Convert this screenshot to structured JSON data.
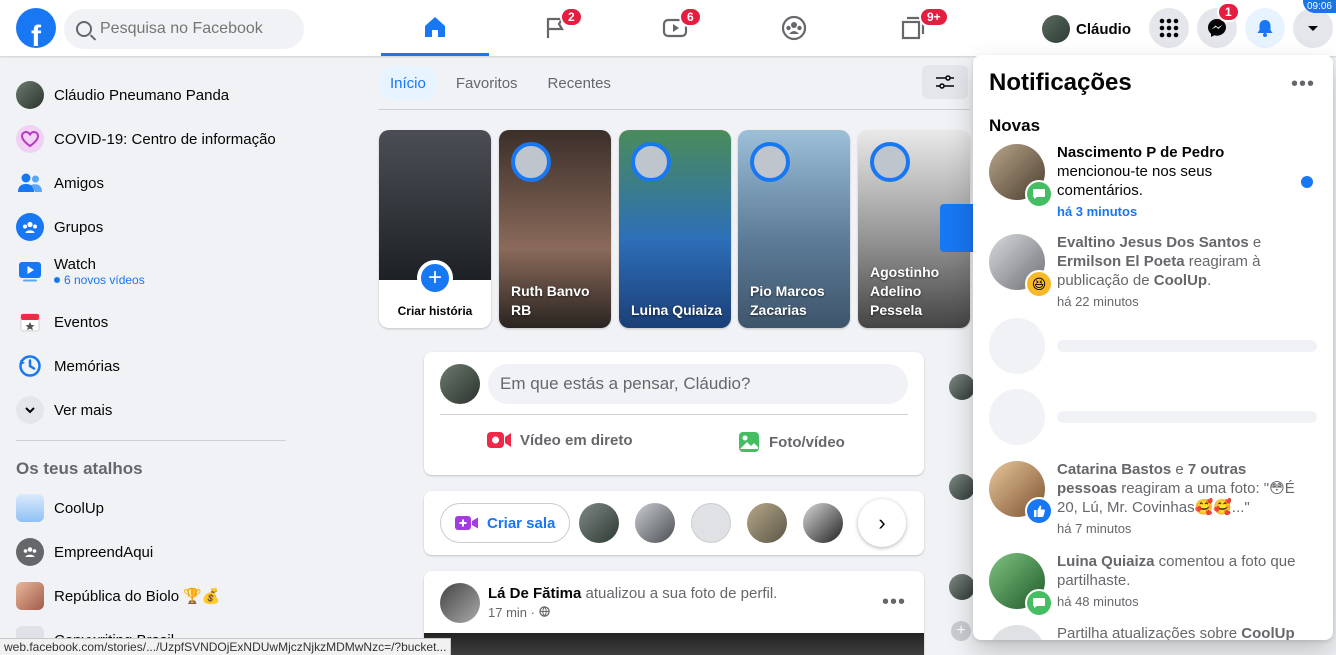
{
  "topbar": {
    "logo": "f",
    "search_placeholder": "Pesquisa no Facebook",
    "nav": [
      {
        "name": "home",
        "badge": ""
      },
      {
        "name": "pages",
        "badge": "2"
      },
      {
        "name": "watch",
        "badge": "6"
      },
      {
        "name": "groups",
        "badge": ""
      },
      {
        "name": "gaming",
        "badge": "9+"
      }
    ],
    "user_name": "Cláudio",
    "messenger_badge": "1",
    "corner_text": "09:06"
  },
  "sidebar": {
    "items": [
      {
        "label": "Cláudio Pneumano Panda",
        "icon": "avatar"
      },
      {
        "label": "COVID-19: Centro de informação",
        "icon": "covid-heart-icon"
      },
      {
        "label": "Amigos",
        "icon": "friends-icon"
      },
      {
        "label": "Grupos",
        "icon": "groups-icon"
      },
      {
        "label": "Watch",
        "sub": "6 novos vídeos",
        "icon": "watch-icon"
      },
      {
        "label": "Eventos",
        "icon": "events-icon"
      },
      {
        "label": "Memórias",
        "icon": "memories-icon"
      },
      {
        "label": "Ver mais",
        "icon": "chevron-down-icon"
      }
    ],
    "shortcuts_title": "Os teus atalhos",
    "shortcuts": [
      {
        "label": "CoolUp"
      },
      {
        "label": "EmpreendAqui"
      },
      {
        "label": "República do Biolo 🏆💰"
      },
      {
        "label": "Copywriting Brasil"
      }
    ]
  },
  "feed": {
    "tabs": [
      "Início",
      "Favoritos",
      "Recentes"
    ],
    "stories": [
      {
        "name": "Criar história"
      },
      {
        "name": "Ruth Banvo RB"
      },
      {
        "name": "Luina Quiaiza"
      },
      {
        "name": "Pio Marcos Zacarias"
      },
      {
        "name": "Agostinho Adelino Pessela"
      }
    ],
    "composer": {
      "placeholder": "Em que estás a pensar, Cláudio?",
      "live": "Vídeo em direto",
      "photo": "Foto/vídeo"
    },
    "rooms": {
      "label": "Criar sala"
    },
    "post": {
      "author": "Lá De Fătima",
      "action": " atualizou a sua foto de perfil.",
      "time": "17 min ·"
    }
  },
  "notifications": {
    "title": "Notificações",
    "section": "Novas",
    "items": [
      {
        "who": "Nascimento P de Pedro",
        "text": " mencionou-te nos seus comentários.",
        "time": "há 3 minutos",
        "unread": true
      },
      {
        "who": "Evaltino Jesus Dos Santos",
        "mid": " e ",
        "who2": "Ermilson El Poeta",
        "text": " reagiram à publicação de ",
        "target": "CoolUp",
        "end": ".",
        "time": "há 22 minutos"
      },
      {
        "who": "Catarina Bastos",
        "mid": " e ",
        "who2": "7 outras pessoas",
        "text": " reagiram a uma foto: \"😳É 20, Lú, Mr. Covinhas🥰🥰...\"",
        "time": "há 7 minutos"
      },
      {
        "who": "Luina Quiaiza",
        "text": " comentou a foto que partilhaste.",
        "time": "há 48 minutos"
      },
      {
        "who": "",
        "text": "Partilha atualizações sobre ",
        "target": "CoolUp"
      }
    ]
  },
  "statusbar": "web.facebook.com/stories/.../UzpfSVNDOjExNDUwMjczNjkzMDMwNzc=/?bucket...",
  "colors": {
    "brand": "#1877f2",
    "badge": "#e41e3f",
    "bg": "#f0f2f5"
  }
}
